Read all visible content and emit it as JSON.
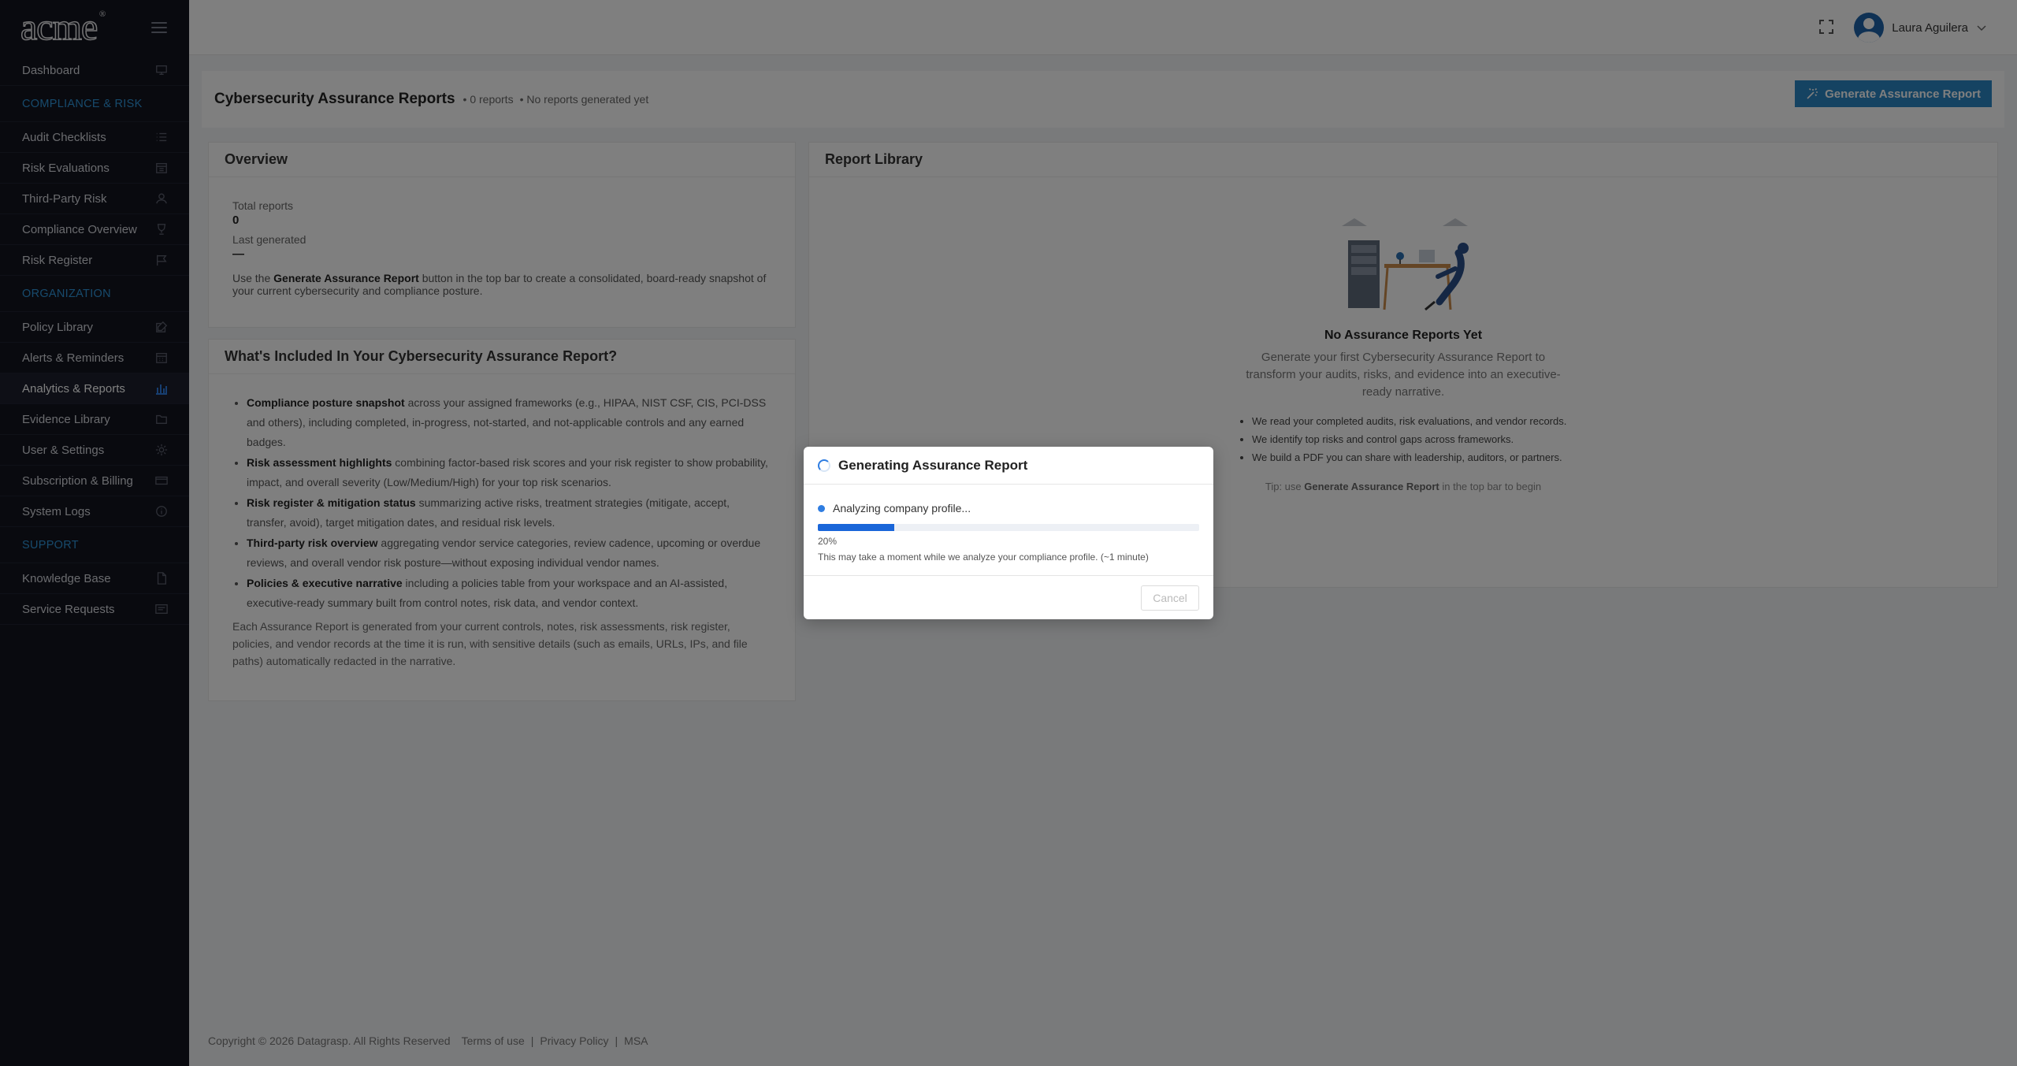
{
  "logo": {
    "text": "acme",
    "mark": "®"
  },
  "sidebar": {
    "items": [
      {
        "label": "Dashboard",
        "icon": "monitor-icon",
        "type": "item"
      },
      {
        "label": "COMPLIANCE & RISK",
        "type": "section"
      },
      {
        "label": "Audit Checklists",
        "icon": "list-icon",
        "type": "item"
      },
      {
        "label": "Risk Evaluations",
        "icon": "calendar-icon",
        "type": "item"
      },
      {
        "label": "Third-Party Risk",
        "icon": "user-icon",
        "type": "item"
      },
      {
        "label": "Compliance Overview",
        "icon": "trophy-icon",
        "type": "item"
      },
      {
        "label": "Risk Register",
        "icon": "flag-icon",
        "type": "item"
      },
      {
        "label": "ORGANIZATION",
        "type": "section"
      },
      {
        "label": "Policy Library",
        "icon": "edit-icon",
        "type": "item"
      },
      {
        "label": "Alerts & Reminders",
        "icon": "calendar-grid-icon",
        "type": "item"
      },
      {
        "label": "Analytics & Reports",
        "icon": "bar-chart-icon",
        "type": "item",
        "active": true
      },
      {
        "label": "Evidence Library",
        "icon": "folder-icon",
        "type": "item"
      },
      {
        "label": "User & Settings",
        "icon": "gear-icon",
        "type": "item"
      },
      {
        "label": "Subscription & Billing",
        "icon": "credit-card-icon",
        "type": "item"
      },
      {
        "label": "System Logs",
        "icon": "info-icon",
        "type": "item"
      },
      {
        "label": "SUPPORT",
        "type": "section"
      },
      {
        "label": "Knowledge Base",
        "icon": "document-icon",
        "type": "item"
      },
      {
        "label": "Service Requests",
        "icon": "message-icon",
        "type": "item"
      }
    ]
  },
  "topbar": {
    "user_name": "Laura Aguilera"
  },
  "header": {
    "title": "Cybersecurity Assurance Reports",
    "report_count": "• 0 reports",
    "status": "• No reports generated yet",
    "generate_label": "Generate Assurance Report"
  },
  "overview": {
    "title": "Overview",
    "total_label": "Total reports",
    "total_value": "0",
    "last_label": "Last generated",
    "last_value": "—",
    "text_pre": "Use the ",
    "text_bold": "Generate Assurance Report",
    "text_post": " button in the top bar to create a consolidated, board-ready snapshot of your current cybersecurity and compliance posture."
  },
  "included": {
    "title": "What's Included In Your Cybersecurity Assurance Report?",
    "items": [
      {
        "bold": "Compliance posture snapshot",
        "text": " across your assigned frameworks (e.g., HIPAA, NIST CSF, CIS, PCI-DSS and others), including completed, in-progress, not-started, and not-applicable controls and any earned badges."
      },
      {
        "bold": "Risk assessment highlights",
        "text": " combining factor-based risk scores and your risk register to show probability, impact, and overall severity (Low/Medium/High) for your top risk scenarios."
      },
      {
        "bold": "Risk register & mitigation status",
        "text": " summarizing active risks, treatment strategies (mitigate, accept, transfer, avoid), target mitigation dates, and residual risk levels."
      },
      {
        "bold": "Third-party risk overview",
        "text": " aggregating vendor service categories, review cadence, upcoming or overdue reviews, and overall vendor risk posture—without exposing individual vendor names."
      },
      {
        "bold": "Policies & executive narrative",
        "text": " including a policies table from your workspace and an AI-assisted, executive-ready summary built from control notes, risk data, and vendor context."
      }
    ],
    "footer": "Each Assurance Report is generated from your current controls, notes, risk assessments, risk register, policies, and vendor records at the time it is run, with sensitive details (such as emails, URLs, IPs, and file paths) automatically redacted in the narrative."
  },
  "library": {
    "title": "Report Library",
    "empty_title": "No Assurance Reports Yet",
    "empty_sub": "Generate your first Cybersecurity Assurance Report to transform your audits, risks, and evidence into an executive-ready narrative.",
    "bullets": [
      "We read your completed audits, risk evaluations, and vendor records.",
      "We identify top risks and control gaps across frameworks.",
      "We build a PDF you can share with leadership, auditors, or partners."
    ],
    "tip_pre": "Tip: use ",
    "tip_bold": "Generate Assurance Report",
    "tip_post": " in the top bar to begin"
  },
  "footer": {
    "copyright": "Copyright © 2026 Datagrasp. All Rights Reserved",
    "terms": "Terms of use",
    "privacy": "Privacy Policy",
    "msa": "MSA",
    "sep": "|"
  },
  "modal": {
    "title": "Generating Assurance Report",
    "step": "Analyzing company profile...",
    "progress": 20,
    "progress_label": "20%",
    "hint": "This may take a moment while we analyze your compliance profile. (~1 minute)",
    "cancel_label": "Cancel"
  },
  "colors": {
    "accent": "#2b86c5",
    "section": "#2f95d9",
    "progress": "#1a66d9",
    "sidebar": "#13151f"
  }
}
